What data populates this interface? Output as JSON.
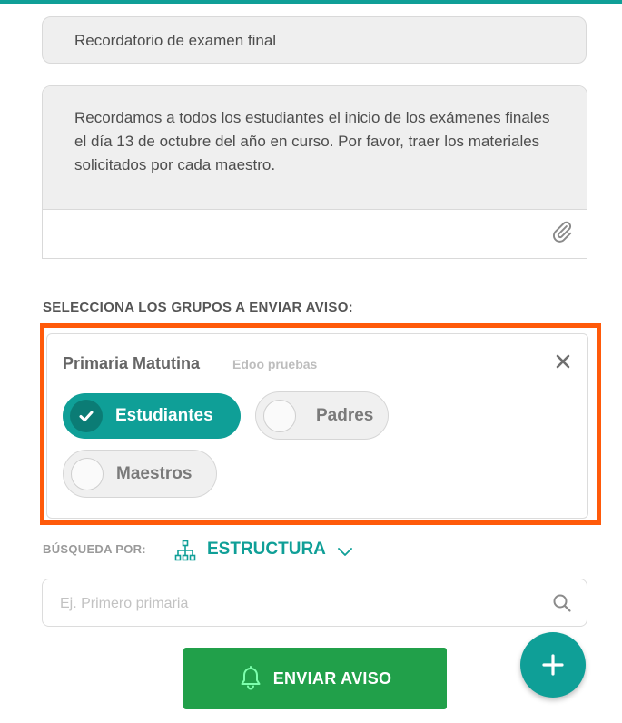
{
  "form": {
    "subject_value": "Recordatorio de examen final",
    "message_value": "Recordamos a todos los estudiantes el inicio de los exámenes finales el día 13 de octubre del año en curso. Por favor, traer los materiales solicitados por cada maestro.",
    "attach_icon": "paperclip-icon"
  },
  "groups": {
    "section_title": "SELECCIONA LOS GRUPOS A ENVIAR AVISO:",
    "highlight_color": "#ff5a0a",
    "card": {
      "title": "Primaria Matutina",
      "subtitle": "Edoo pruebas",
      "close_icon": "close-icon",
      "options": [
        {
          "label": "Estudiantes",
          "selected": true
        },
        {
          "label": "Padres",
          "selected": false
        },
        {
          "label": "Maestros",
          "selected": false
        }
      ]
    }
  },
  "search": {
    "by_label": "BÚSQUEDA POR:",
    "mode_label": "ESTRUCTURA",
    "mode_icon": "hierarchy-icon",
    "placeholder": "Ej. Primero primaria"
  },
  "actions": {
    "send_label": "ENVIAR AVISO",
    "send_icon": "bell-icon",
    "fab_icon": "plus-icon"
  },
  "colors": {
    "accent": "#0f9f97",
    "send_button": "#21a04a"
  }
}
